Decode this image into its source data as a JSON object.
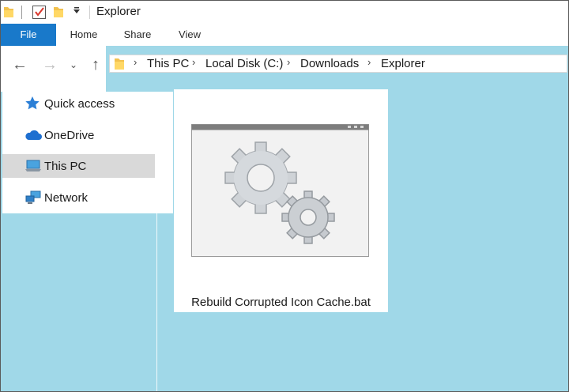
{
  "window": {
    "title": "Explorer"
  },
  "quick_access_toolbar": {
    "items": [
      "folder-icon",
      "properties-icon",
      "new-folder-icon",
      "customize-dropdown-icon"
    ]
  },
  "ribbon": {
    "tabs": [
      {
        "label": "File",
        "active": true
      },
      {
        "label": "Home"
      },
      {
        "label": "Share"
      },
      {
        "label": "View"
      }
    ]
  },
  "navigation": {
    "back_glyph": "←",
    "forward_glyph": "→",
    "recent_glyph": "⌄",
    "up_glyph": "↑"
  },
  "address_bar": {
    "separator": "›",
    "breadcrumbs": [
      "This PC",
      "Local Disk (C:)",
      "Downloads",
      "Explorer"
    ]
  },
  "sidebar": {
    "items": [
      {
        "label": "Quick access",
        "icon": "star-icon"
      },
      {
        "label": "OneDrive",
        "icon": "cloud-icon"
      },
      {
        "label": "This PC",
        "icon": "computer-icon",
        "selected": true
      },
      {
        "label": "Network",
        "icon": "network-icon"
      }
    ]
  },
  "content": {
    "files": [
      {
        "name": "Rebuild Corrupted Icon Cache.bat",
        "icon": "batch-file-gears-icon"
      }
    ]
  },
  "colors": {
    "file_tab": "#1979ca",
    "content_background": "#a0d8e8",
    "selected_item": "#d9d9d9"
  }
}
